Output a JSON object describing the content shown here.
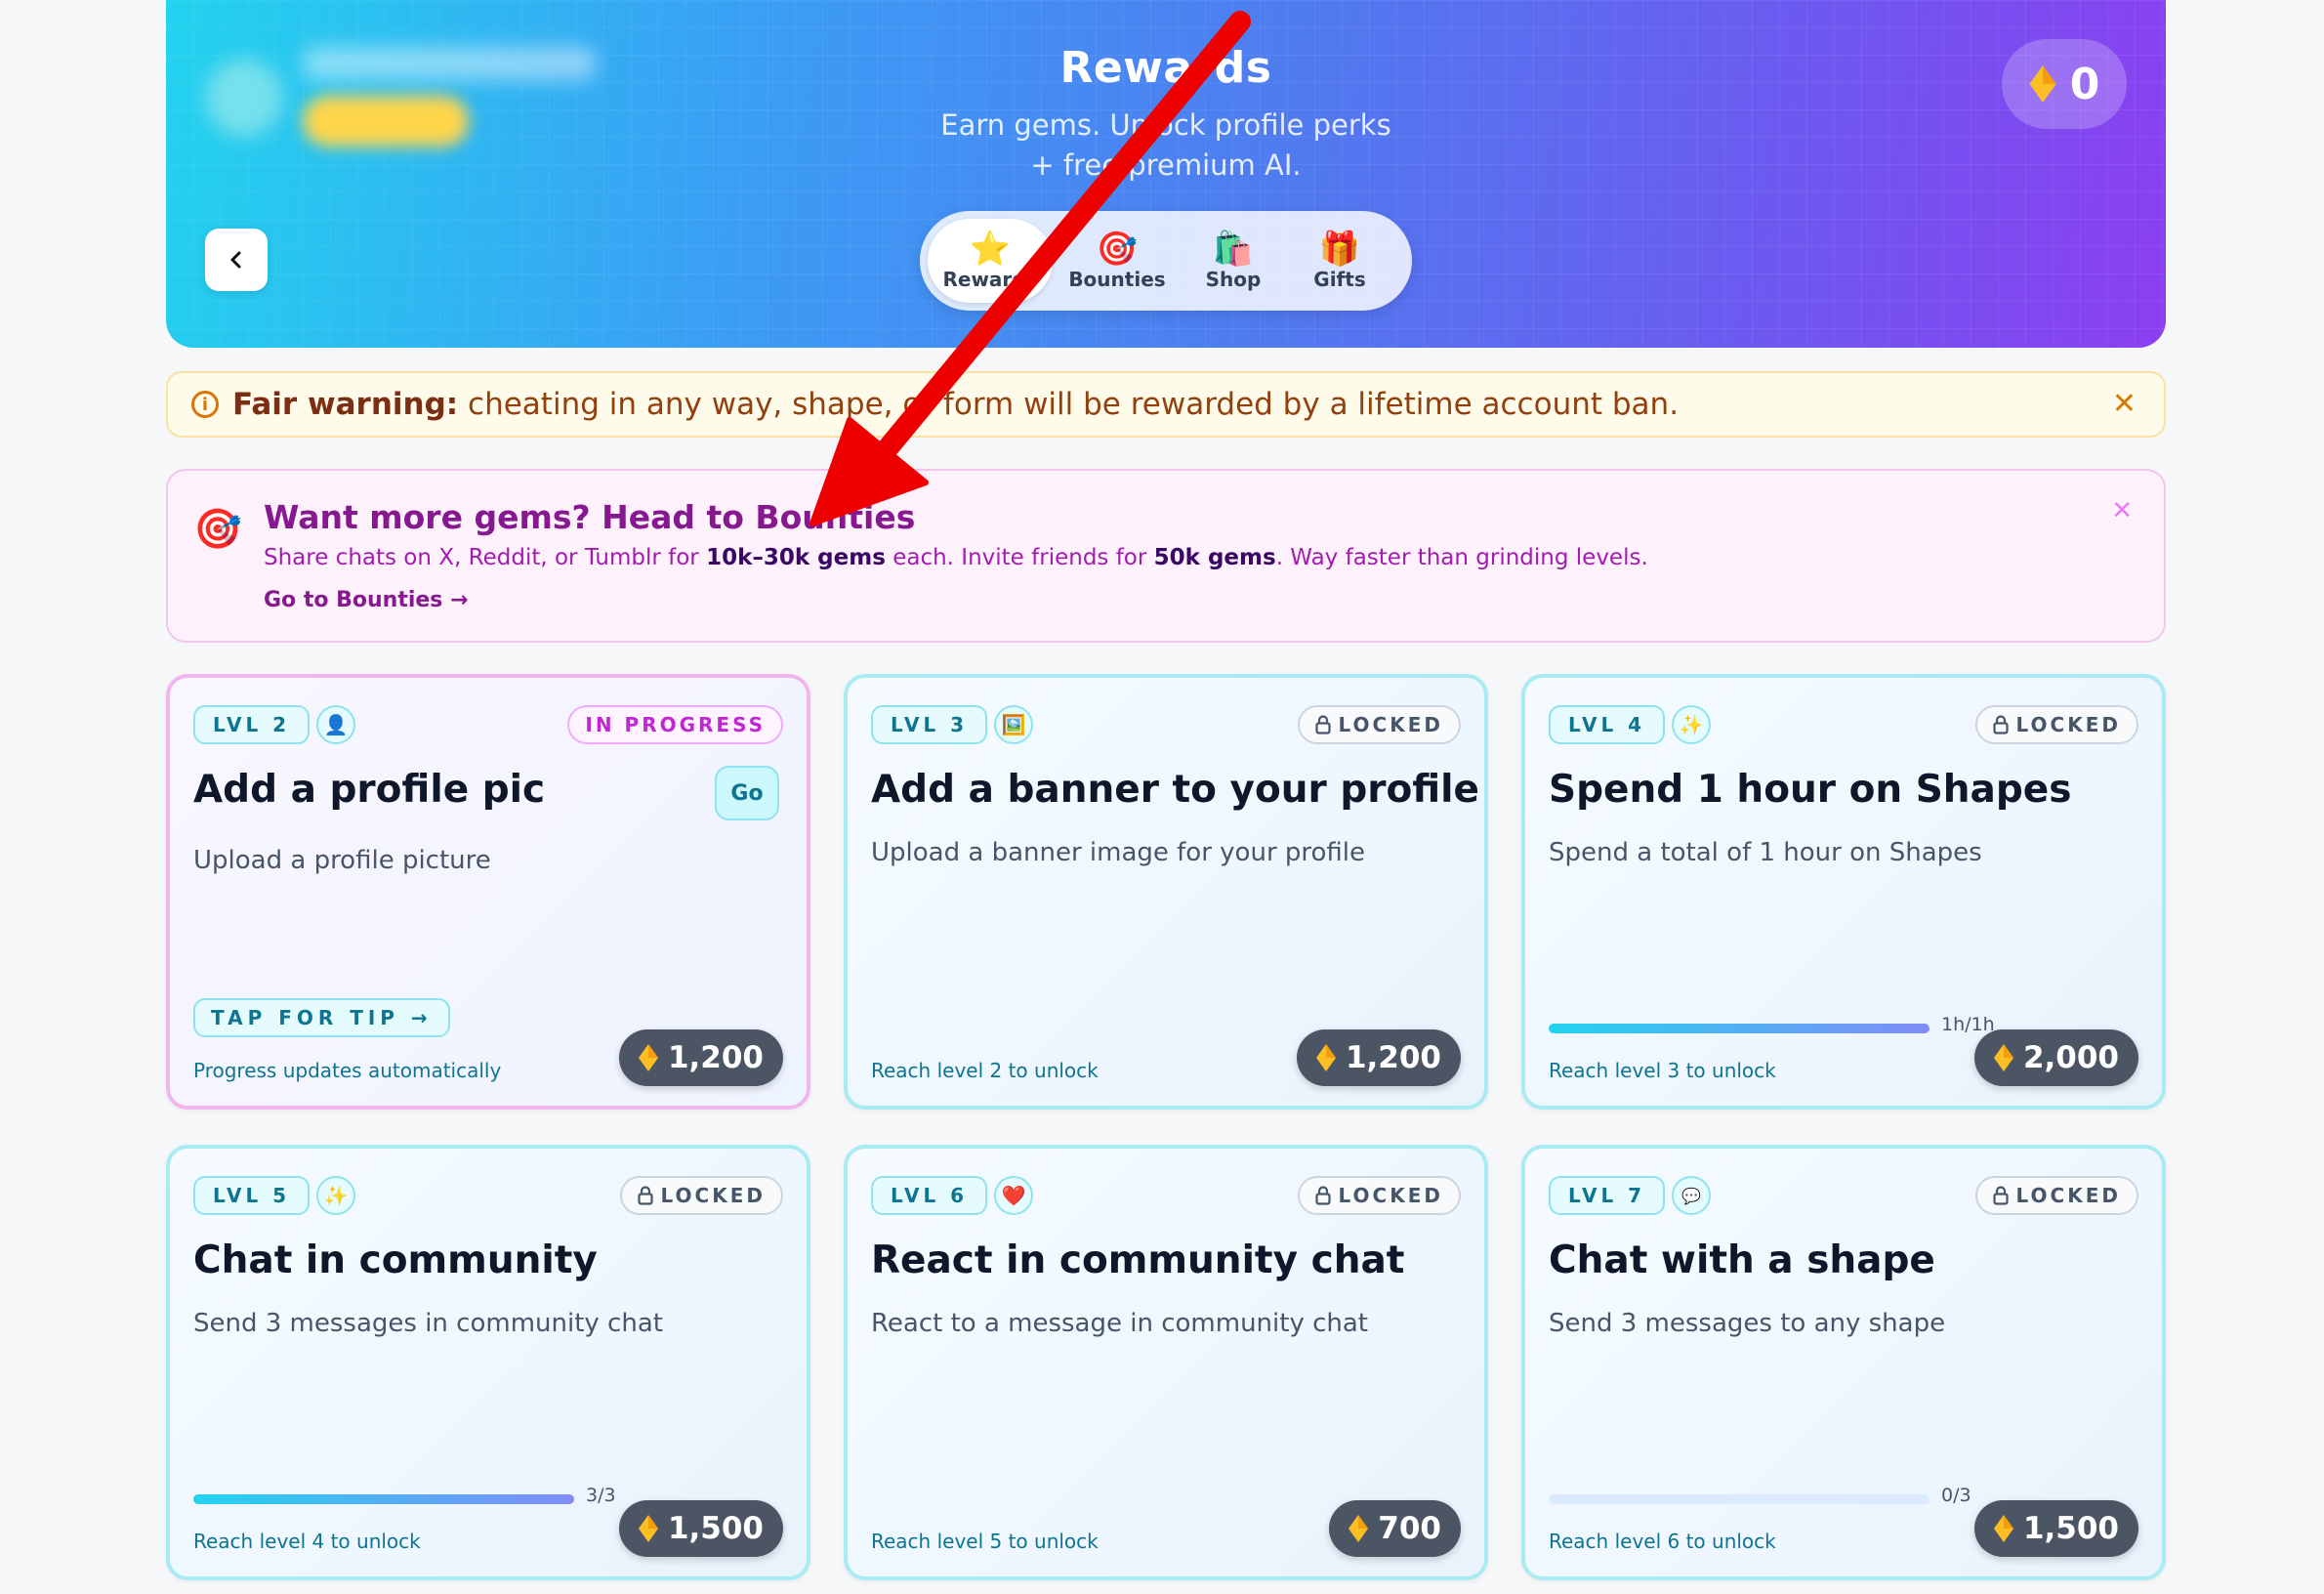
{
  "hero": {
    "title": "Rewards",
    "subtitle_line1": "Earn gems. Unlock profile perks",
    "subtitle_line2": "+ free premium AI.",
    "gem_count": "0"
  },
  "tabs": [
    {
      "label": "Rewards",
      "icon": "star-icon"
    },
    {
      "label": "Bounties",
      "icon": "target-icon"
    },
    {
      "label": "Shop",
      "icon": "shopping-bags-icon"
    },
    {
      "label": "Gifts",
      "icon": "gift-icon"
    }
  ],
  "warning": {
    "prefix": "Fair warning:",
    "text": "cheating in any way, shape, or form will be rewarded by a lifetime account ban."
  },
  "promo": {
    "title": "Want more gems? Head to Bounties",
    "desc_part1": "Share chats on X, Reddit, or Tumblr for ",
    "desc_bold1": "10k–30k gems",
    "desc_part2": " each. Invite friends for ",
    "desc_bold2": "50k gems",
    "desc_part3": ". Way faster than grinding levels.",
    "link": "Go to Bounties →"
  },
  "cards": [
    {
      "level": "LVL 2",
      "icon": "person-icon",
      "status": "IN PROGRESS",
      "title": "Add a profile pic",
      "desc": "Upload a profile picture",
      "go": "Go",
      "tip": "TAP FOR TIP →",
      "footer": "Progress updates automatically",
      "reward": "1,200"
    },
    {
      "level": "LVL 3",
      "icon": "picture-icon",
      "status": "LOCKED",
      "title": "Add a banner to your profile",
      "desc": "Upload a banner image for your profile",
      "footer": "Reach level 2 to unlock",
      "reward": "1,200"
    },
    {
      "level": "LVL 4",
      "icon": "sparkles-icon",
      "status": "LOCKED",
      "title": "Spend 1 hour on Shapes",
      "desc": "Spend a total of 1 hour on Shapes",
      "progress_label": "1h/1h",
      "progress": 1.0,
      "footer": "Reach level 3 to unlock",
      "reward": "2,000"
    },
    {
      "level": "LVL 5",
      "icon": "sparkles-icon",
      "status": "LOCKED",
      "title": "Chat in community",
      "desc": "Send 3 messages in community chat",
      "progress_label": "3/3",
      "progress": 1.0,
      "footer": "Reach level 4 to unlock",
      "reward": "1,500"
    },
    {
      "level": "LVL 6",
      "icon": "heart-icon",
      "status": "LOCKED",
      "title": "React in community chat",
      "desc": "React to a message in community chat",
      "footer": "Reach level 5 to unlock",
      "reward": "700"
    },
    {
      "level": "LVL 7",
      "icon": "speech-bubble-icon",
      "status": "LOCKED",
      "title": "Chat with a shape",
      "desc": "Send 3 messages to any shape",
      "progress_label": "0/3",
      "progress": 0.0,
      "footer": "Reach level 6 to unlock",
      "reward": "1,500"
    }
  ],
  "colors": {
    "accent": "#22d3ee",
    "promo": "#86198f",
    "warning": "#92400e",
    "annotation_arrow": "#ee0000"
  }
}
